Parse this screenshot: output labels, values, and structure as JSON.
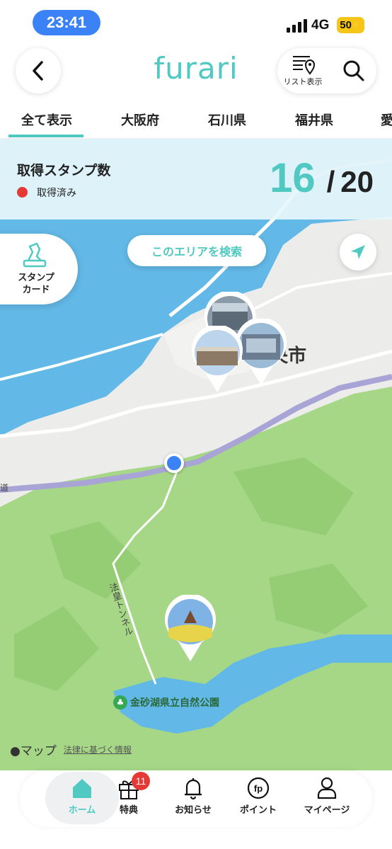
{
  "status_bar": {
    "time": "23:41",
    "network": "4G",
    "battery": "50"
  },
  "header": {
    "logo": "furari",
    "list_view_label": "リスト表示"
  },
  "tabs": [
    {
      "label": "全て表示",
      "active": true
    },
    {
      "label": "大阪府"
    },
    {
      "label": "石川県"
    },
    {
      "label": "福井県"
    },
    {
      "label": "愛"
    }
  ],
  "stamp_summary": {
    "title": "取得スタンプ数",
    "legend_label": "取得済み",
    "legend_color": "#e53935",
    "collected": "16",
    "separator": "/",
    "total": "20"
  },
  "map": {
    "stamp_card_label_line1": "スタンプ",
    "stamp_card_label_line2": "カード",
    "area_search_label": "このエリアを検索",
    "city_label": "央市",
    "tunnel_label": "法皇トンネル",
    "park_label": "金砂湖県立自然公園",
    "road_label": "道",
    "attribution": "マップ",
    "legal_link": "法律に基づく情報"
  },
  "bottom_nav": [
    {
      "label": "ホーム",
      "icon": "home-icon",
      "active": true
    },
    {
      "label": "特典",
      "icon": "gift-icon",
      "badge": "11"
    },
    {
      "label": "お知らせ",
      "icon": "bell-icon"
    },
    {
      "label": "ポイント",
      "icon": "fp-icon"
    },
    {
      "label": "マイページ",
      "icon": "person-icon"
    }
  ],
  "colors": {
    "accent": "#4fc9c1",
    "user_location": "#3b82f6",
    "badge": "#e53935"
  }
}
